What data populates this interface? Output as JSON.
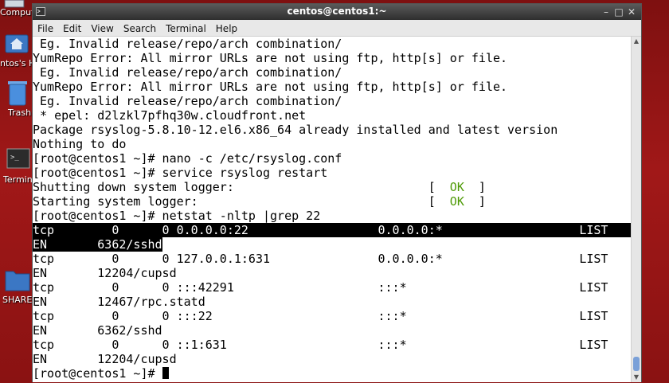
{
  "desktop": {
    "icons": [
      {
        "label": "Comput",
        "icon": "computer-icon"
      },
      {
        "label": "ntos's H",
        "icon": "home-folder-icon"
      },
      {
        "label": "Trash",
        "icon": "trash-icon"
      },
      {
        "label": "Termin",
        "icon": "terminal-icon"
      },
      {
        "label": "SHARE",
        "icon": "folder-icon"
      }
    ]
  },
  "window": {
    "title": "centos@centos1:~",
    "controls": {
      "minimize": "–",
      "maximize": "□",
      "close": "✕"
    },
    "menu": [
      "File",
      "Edit",
      "View",
      "Search",
      "Terminal",
      "Help"
    ]
  },
  "terminal": {
    "lines": [
      " Eg. Invalid release/repo/arch combination/",
      "YumRepo Error: All mirror URLs are not using ftp, http[s] or file.",
      " Eg. Invalid release/repo/arch combination/",
      "YumRepo Error: All mirror URLs are not using ftp, http[s] or file.",
      " Eg. Invalid release/repo/arch combination/",
      " * epel: d2lzkl7pfhq30w.cloudfront.net",
      "Package rsyslog-5.8.10-12.el6.x86_64 already installed and latest version",
      "Nothing to do",
      "[root@centos1 ~]# nano -c /etc/rsyslog.conf",
      "[root@centos1 ~]# service rsyslog restart"
    ],
    "status_lines": [
      {
        "text": "Shutting down system logger:                           ",
        "open": "[  ",
        "ok": "OK",
        "close": "  ]"
      },
      {
        "text": "Starting system logger:                                ",
        "open": "[  ",
        "ok": "OK",
        "close": "  ]"
      }
    ],
    "command": "[root@centos1 ~]# netstat -nltp |grep 22",
    "highlight_a": "tcp        0      0 0.0.0.0:22                  0.0.0.0:*                   LIST",
    "highlight_b": "EN       6362/sshd",
    "output": [
      "tcp        0      0 127.0.0.1:631               0.0.0.0:*                   LIST",
      "EN       12204/cupsd",
      "tcp        0      0 :::42291                    :::*                        LIST",
      "EN       12467/rpc.statd",
      "tcp        0      0 :::22                       :::*                        LIST",
      "EN       6362/sshd",
      "tcp        0      0 ::1:631                     :::*                        LIST",
      "EN       12204/cupsd"
    ],
    "prompt": "[root@centos1 ~]# "
  },
  "colors": {
    "ok": "#4e9a06",
    "highlight_bg": "#000000",
    "desktop": "#a11818"
  }
}
